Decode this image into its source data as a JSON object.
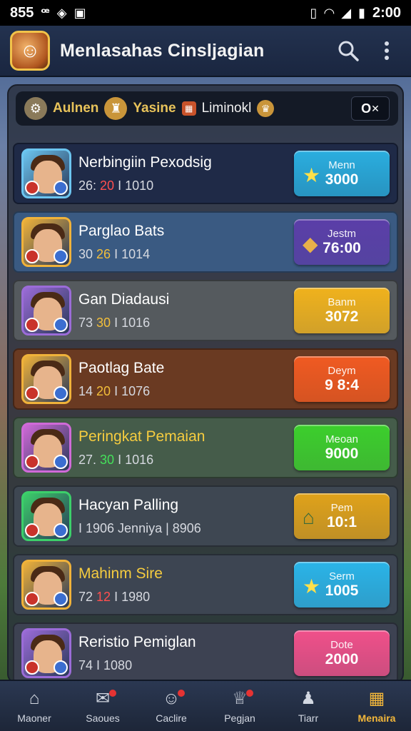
{
  "status": {
    "time_left": "855",
    "time_right": "2:00",
    "icons": [
      "signal-glyph-icon",
      "dropbox-icon",
      "image-icon",
      "nfc-icon",
      "wifi-icon",
      "cell-signal-icon",
      "battery-icon"
    ]
  },
  "header": {
    "title": "Menlasahas Cinsljagian",
    "search_icon": "search-icon",
    "menu_icon": "more-vert-icon"
  },
  "filter": {
    "label1": "Aulnen",
    "label2": "Yasine",
    "label3": "Liminokl",
    "toggle": "O"
  },
  "rows": [
    {
      "name": "Nerbingiin Pexodsig",
      "stats_a": "26:",
      "stats_b": "20",
      "stats_c": "I  1010",
      "reward_label": "Menn",
      "reward_value": "3000",
      "reward_color": "#2aaedf",
      "frame": "#6cc5f0",
      "row_bg": "#1f2a47",
      "gold": false,
      "hi": "red"
    },
    {
      "name": "Parglao Bats",
      "stats_a": "30",
      "stats_b": "26",
      "stats_c": "I  1014",
      "reward_label": "Jestm",
      "reward_value": "76:00",
      "reward_color": "#5b3ea8",
      "frame": "#f0b23a",
      "row_bg": "#3a5a82",
      "gold": false,
      "hi": "gold"
    },
    {
      "name": "Gan Diadausi",
      "stats_a": "73",
      "stats_b": "30",
      "stats_c": "I  1016",
      "reward_label": "Banm",
      "reward_value": "3072",
      "reward_color": "#f0b21c",
      "frame": "#9b6cd8",
      "row_bg": "#555a5e",
      "gold": false,
      "hi": "gold"
    },
    {
      "name": "Paotlag Bate",
      "stats_a": "14",
      "stats_b": "20",
      "stats_c": "I  1076",
      "reward_label": "Deym",
      "reward_value": "9 8:4",
      "reward_color": "#f05a22",
      "frame": "#f0b23a",
      "row_bg": "#6a3a22",
      "gold": false,
      "hi": "gold"
    },
    {
      "name": "Peringkat Pemaian",
      "stats_a": "27.",
      "stats_b": "30",
      "stats_c": "I  1016",
      "reward_label": "Meoan",
      "reward_value": "9000",
      "reward_color": "#3ccf2c",
      "frame": "#d06ad8",
      "row_bg": "#455c4a",
      "gold": true,
      "hi": "green"
    },
    {
      "name": "Hacyan Palling",
      "stats_a": "",
      "stats_b": "",
      "stats_c": "I  1906 Jenniya | 8906",
      "reward_label": "Pem",
      "reward_value": "10:1",
      "reward_color": "#e0a21a",
      "frame": "#3ccf6a",
      "row_bg": "#3e4752",
      "gold": false,
      "hi": "red"
    },
    {
      "name": "Mahinm Sire",
      "stats_a": "72",
      "stats_b": "12",
      "stats_c": "I  1980",
      "reward_label": "Serm",
      "reward_value": "1005",
      "reward_color": "#2ab4e8",
      "frame": "#f0b23a",
      "row_bg": "#3d4552",
      "gold": true,
      "hi": "red"
    },
    {
      "name": "Reristio Pemiglan",
      "stats_a": "74",
      "stats_b": "",
      "stats_c": "I  1080",
      "reward_label": "Dote",
      "reward_value": "2000",
      "reward_color": "#f0508a",
      "frame": "#9b6cd8",
      "row_bg": "#3d4252",
      "gold": false,
      "hi": "gold"
    }
  ],
  "nav": [
    {
      "label": "Maoner",
      "icon": "home-icon",
      "dot": false,
      "active": false
    },
    {
      "label": "Saoues",
      "icon": "mail-icon",
      "dot": true,
      "active": false
    },
    {
      "label": "Caclire",
      "icon": "smiley-icon",
      "dot": true,
      "active": false
    },
    {
      "label": "Pegjan",
      "icon": "trophy-icon",
      "dot": true,
      "active": false
    },
    {
      "label": "Tiarr",
      "icon": "friends-icon",
      "dot": false,
      "active": false
    },
    {
      "label": "Menaira",
      "icon": "shop-icon",
      "dot": false,
      "active": true
    }
  ]
}
